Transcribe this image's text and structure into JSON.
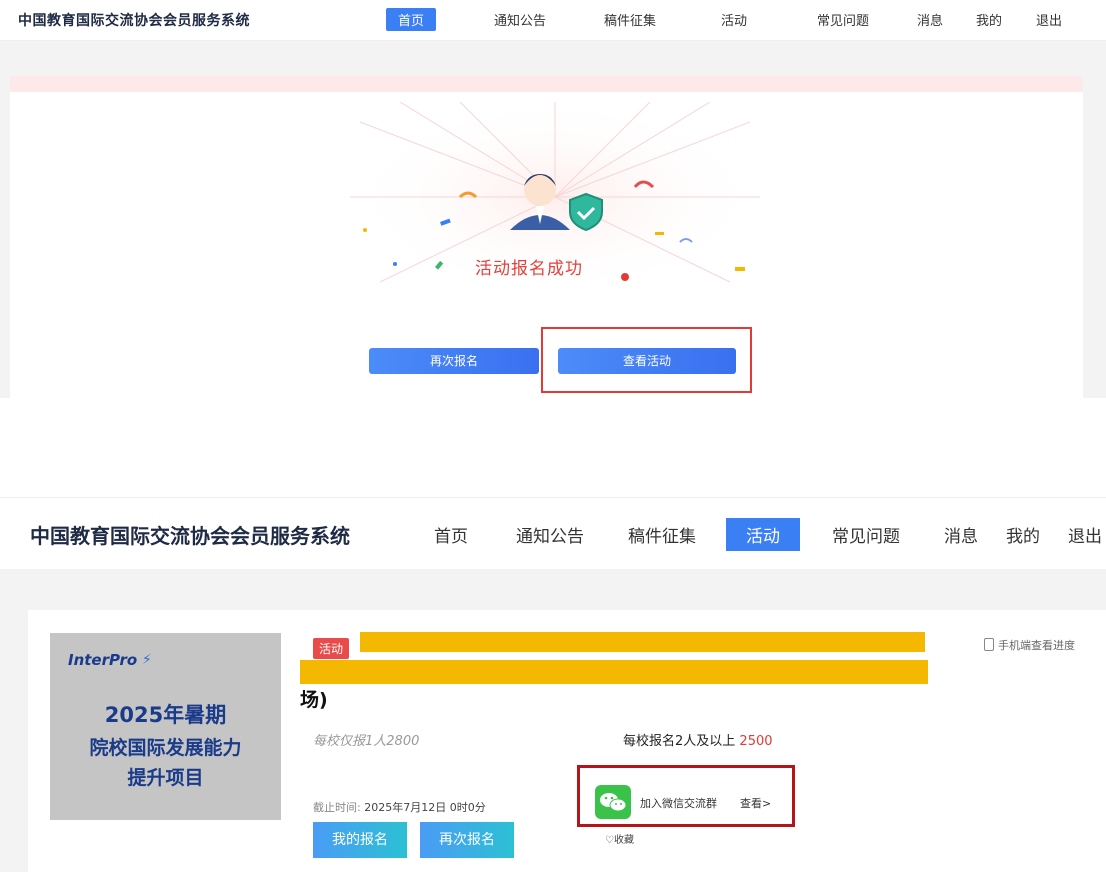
{
  "top": {
    "nav": {
      "brand": "中国教育国际交流协会会员服务系统",
      "items": [
        "首页",
        "通知公告",
        "稿件征集",
        "活动",
        "常见问题",
        "消息",
        "我的",
        "退出"
      ],
      "active": "首页"
    },
    "success_title": "活动报名成功",
    "buttons": {
      "reapply": "再次报名",
      "view_activity": "查看活动"
    }
  },
  "bottom": {
    "nav": {
      "brand": "中国教育国际交流协会会员服务系统",
      "items": [
        "首页",
        "通知公告",
        "稿件征集",
        "活动",
        "常见问题",
        "消息",
        "我的",
        "退出"
      ],
      "active": "活动"
    },
    "poster": {
      "logo": "InterPro",
      "line1": "2025年暑期",
      "line2": "院校国际发展能力",
      "line3": "提升项目"
    },
    "tag": "活动",
    "title_end": "场)",
    "mobile_progress": "手机端查看进度",
    "price_single": "每校仅报1人2800",
    "price_multi_label": "每校报名2人及以上",
    "price_multi_value": "2500",
    "deadline_label": "截止时间:",
    "deadline_value": "2025年7月12日 0时0分",
    "buttons": {
      "my_signup": "我的报名",
      "reapply": "再次报名"
    },
    "wechat": {
      "label": "加入微信交流群",
      "view": "查看>"
    },
    "favorite": "收藏"
  },
  "colors": {
    "accent": "#3b7ff5",
    "success_red": "#e5413b",
    "highlight_red": "#e53935",
    "wechat_green": "#3bc24a",
    "redaction": "#f5b800"
  }
}
